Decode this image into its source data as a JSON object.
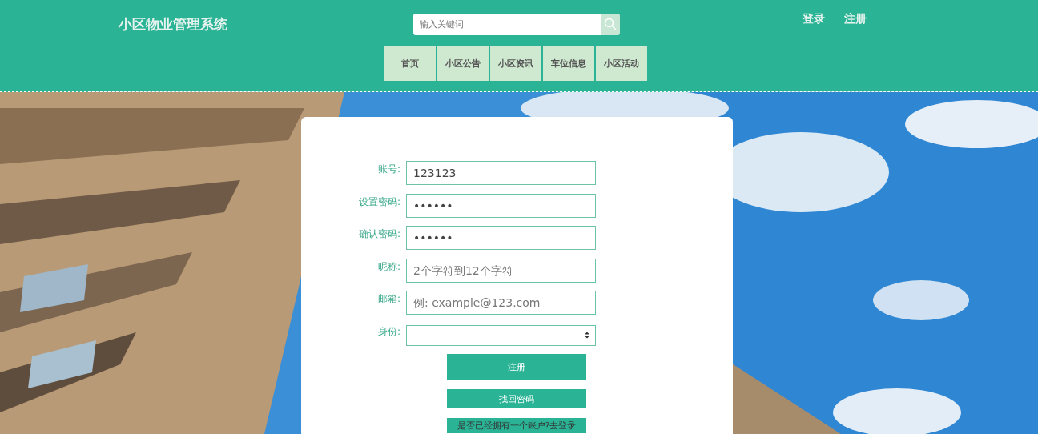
{
  "header": {
    "site_title": "小区物业管理系统",
    "search": {
      "placeholder": "输入关键词"
    },
    "auth_links": [
      "登录",
      "注册"
    ]
  },
  "nav": [
    {
      "label": "首页",
      "selected": false
    },
    {
      "label": "小区公告",
      "selected": false
    },
    {
      "label": "小区资讯",
      "selected": false
    },
    {
      "label": "车位信息",
      "selected": false
    },
    {
      "label": "小区活动",
      "selected": false
    }
  ],
  "form": {
    "fields": [
      {
        "label": "账号:",
        "kind": "text",
        "value": "123123"
      },
      {
        "label": "设置密码:",
        "kind": "text",
        "value": "••••••"
      },
      {
        "label": "确认密码:",
        "kind": "text",
        "value": "••••••"
      },
      {
        "label": "昵称:",
        "kind": "text",
        "placeholder": "2个字符到12个字符"
      },
      {
        "label": "邮箱:",
        "kind": "text",
        "placeholder": "例: example@123.com"
      },
      {
        "label": "身份:",
        "kind": "select"
      }
    ],
    "buttons": [
      "注册",
      "找回密码",
      "是否已经拥有一个账户?去登录"
    ]
  }
}
